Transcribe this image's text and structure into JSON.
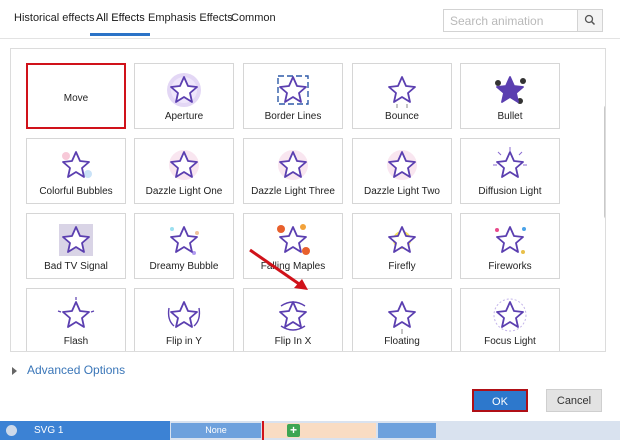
{
  "tabs": [
    {
      "label": "Historical effects",
      "active": false
    },
    {
      "label": "All Effects",
      "active": true
    },
    {
      "label": "Emphasis Effects",
      "active": false
    },
    {
      "label": "Common",
      "active": false
    }
  ],
  "search": {
    "placeholder": "Search animation",
    "icon": "search-icon"
  },
  "effects": [
    {
      "label": "Move",
      "icon": "none",
      "selected": true
    },
    {
      "label": "Aperture",
      "icon": "aperture-star-icon"
    },
    {
      "label": "Border Lines",
      "icon": "border-lines-star-icon"
    },
    {
      "label": "Bounce",
      "icon": "bounce-star-icon"
    },
    {
      "label": "Bullet",
      "icon": "bullet-star-icon"
    },
    {
      "label": "Colorful Bubbles",
      "icon": "colorful-bubbles-star-icon"
    },
    {
      "label": "Dazzle Light One",
      "icon": "dazzle-star-icon"
    },
    {
      "label": "Dazzle Light Three",
      "icon": "dazzle-star-icon"
    },
    {
      "label": "Dazzle Light Two",
      "icon": "dazzle-star-icon"
    },
    {
      "label": "Diffusion Light",
      "icon": "diffusion-star-icon"
    },
    {
      "label": "Bad TV Signal",
      "icon": "bad-tv-star-icon"
    },
    {
      "label": "Dreamy Bubble",
      "icon": "dreamy-star-icon"
    },
    {
      "label": "Falling Maples",
      "icon": "maple-star-icon"
    },
    {
      "label": "Firefly",
      "icon": "firefly-star-icon"
    },
    {
      "label": "Fireworks",
      "icon": "fireworks-star-icon"
    },
    {
      "label": "Flash",
      "icon": "flash-star-icon"
    },
    {
      "label": "Flip in Y",
      "icon": "flip-y-star-icon"
    },
    {
      "label": "Flip In X",
      "icon": "flip-x-star-icon"
    },
    {
      "label": "Floating",
      "icon": "floating-star-icon"
    },
    {
      "label": "Focus Light",
      "icon": "focus-star-icon"
    }
  ],
  "advanced_options": "Advanced Options",
  "buttons": {
    "ok": "OK",
    "cancel": "Cancel"
  },
  "timeline": {
    "layer": "SVG 1",
    "none_label": "None"
  },
  "colors": {
    "star": "#5b3fb0",
    "accent": "#2d78cc",
    "highlight": "#d0121a"
  }
}
